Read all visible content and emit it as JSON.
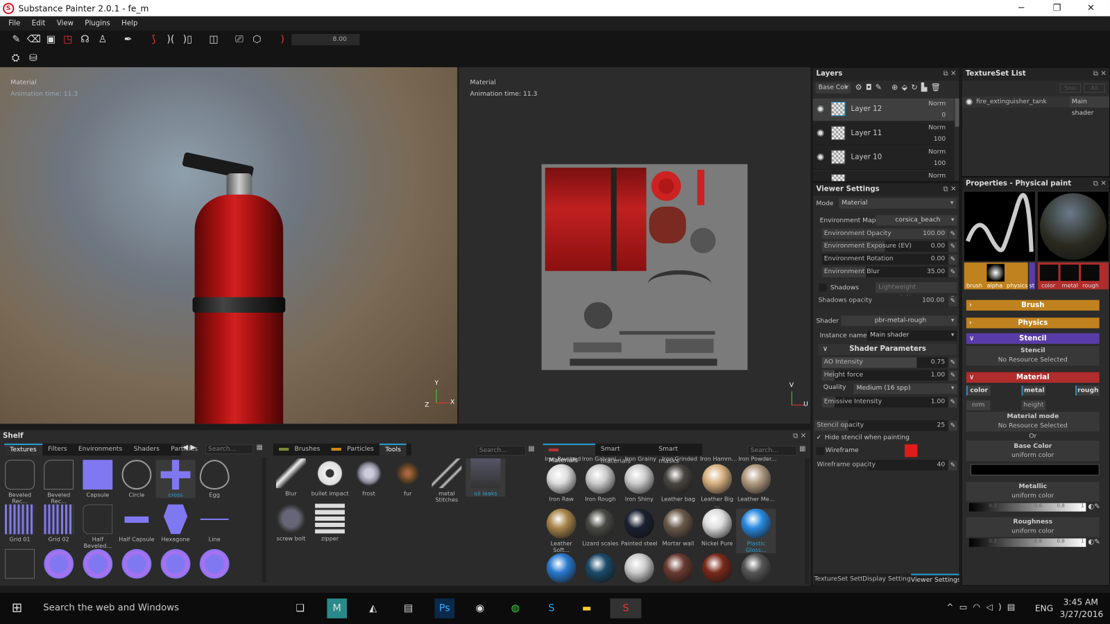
{
  "window": {
    "title": "Substance Painter 2.0.1 - fe_m",
    "min": "─",
    "max": "❐",
    "close": "✕"
  },
  "menu": [
    "File",
    "Edit",
    "View",
    "Plugins",
    "Help"
  ],
  "toolbar": {
    "brush_size": "8.00",
    "icons": [
      "paint-brush-icon",
      "eraser-icon",
      "projection-icon",
      "polygon-fill-icon",
      "smudge-icon",
      "clone-stamp-icon",
      "color-picker-icon",
      "symmetry-icon",
      "mirror-x-icon",
      "mirror-icon",
      "view-mode-icon",
      "camera-icon",
      "cube-icon",
      "lazy-mouse-icon",
      "substance-share-icon",
      "substance-store-icon"
    ]
  },
  "viewport3d": {
    "mode": "Material",
    "animation_time": "Animation time: 11.3",
    "axis_x": "X",
    "axis_y": "Y",
    "axis_z": "Z"
  },
  "viewport2d": {
    "mode": "Material",
    "animation_time": "Animation time: 11.3",
    "axis_u": "U",
    "axis_v": "V"
  },
  "layers": {
    "title": "Layers",
    "channel": "Base Colr",
    "items": [
      {
        "name": "Layer 12",
        "blend": "Norm",
        "opacity": "0",
        "selected": true
      },
      {
        "name": "Layer 11",
        "blend": "Norm",
        "opacity": "100"
      },
      {
        "name": "Layer 10",
        "blend": "Norm",
        "opacity": "100"
      },
      {
        "name": "",
        "blend": "Norm",
        "opacity": ""
      }
    ]
  },
  "textureset": {
    "title": "TextureSet List",
    "solo": "Solo",
    "all": "All",
    "item": "fire_extinguisher_tank",
    "shader": "Main shader"
  },
  "viewer": {
    "title": "Viewer Settings",
    "mode_label": "Mode",
    "mode": "Material",
    "env_map_label": "Environment Map",
    "env_map": "corsica_beach",
    "sliders": [
      {
        "label": "Environment Opacity",
        "value": "100.00",
        "fill": 1.0
      },
      {
        "label": "Environment Exposure (EV)",
        "value": "0.00",
        "fill": 0.5
      },
      {
        "label": "Environment Rotation",
        "value": "0.00",
        "fill": 0.0
      },
      {
        "label": "Environment Blur",
        "value": "35.00",
        "fill": 0.35
      }
    ],
    "shadows_label": "Shadows",
    "shadows_mode": "Lightweight computation",
    "shadows_opacity_label": "Shadows opacity",
    "shadows_opacity": "100.00",
    "shader_label": "Shader",
    "shader": "pbr-metal-rough",
    "instance_label": "Instance name",
    "instance": "Main shader",
    "shader_params": "Shader Parameters",
    "params": [
      {
        "label": "AO Intensity",
        "value": "0.75",
        "fill": 0.75
      },
      {
        "label": "Height force",
        "value": "1.00",
        "fill": 0.1
      }
    ],
    "quality_label": "Quality",
    "quality": "Medium (16 spp)",
    "emissive_label": "Emissive Intensity",
    "emissive": "1.00",
    "stencil_opacity_label": "Stencil opacity",
    "stencil_opacity": "25",
    "hide_stencil": "Hide stencil when painting",
    "wireframe": "Wireframe",
    "wireframe_color": "#e01b1b",
    "wireframe_opacity_label": "Wireframe opacity",
    "wireframe_opacity": "40"
  },
  "bottom_tabs": [
    {
      "label": "TextureSet Settings"
    },
    {
      "label": "Display Settings"
    },
    {
      "label": "Viewer Settings",
      "active": true
    }
  ],
  "properties": {
    "title": "Properties - Physical paint",
    "brush_slots": [
      "brush",
      "alpha",
      "physics",
      "st"
    ],
    "mat_slots": [
      "color",
      "metal",
      "rough"
    ],
    "sections": {
      "brush": "Brush",
      "physics": "Physics",
      "stencil": "Stencil",
      "material": "Material"
    },
    "stencil_title": "Stencil",
    "stencil_value": "No Resource Selected",
    "channels": [
      "color",
      "metal",
      "rough",
      "nrm",
      "height"
    ],
    "material_mode": "Material mode",
    "material_mode_value": "No Resource Selected",
    "or": "Or",
    "base_color": "Base Color",
    "base_color_sub": "uniform color",
    "metallic": "Metallic",
    "metallic_sub": "uniform color",
    "roughness": "Roughness",
    "roughness_sub": "uniform color",
    "ticks": [
      "0.2",
      "0.4",
      "0.6",
      "0.8",
      "1"
    ],
    "colors": {
      "brush": "#c0821e",
      "stencil": "#5a3ca8",
      "material": "#b12c2c"
    }
  },
  "shelf": {
    "title": "Shelf",
    "search": "Search...",
    "tabs1": [
      "Textures",
      "Filters",
      "Environments",
      "Shaders",
      "Particles"
    ],
    "textures": [
      "Beveled Rec...",
      "Beveled Rec...",
      "Capsule",
      "Circle",
      "cross",
      "Egg",
      "Grid 01",
      "Grid 02",
      "Half Beveled...",
      "Half Capsule",
      "Hexagone",
      "Line"
    ],
    "tabs2": [
      "Brushes",
      "Particles",
      "Tools"
    ],
    "tools": [
      "Blur",
      "bullet impact",
      "frost",
      "fur",
      "metal Stitches",
      "oil leaks",
      "screw bolt",
      "zipper"
    ],
    "tabs3": [
      "Materials",
      "Smart materials",
      "Smart masks"
    ],
    "materials_top": [
      "Iron Brushed",
      "Iron Galvani...",
      "Iron Grainy",
      "Iron Grinded",
      "Iron Hamm...",
      "Iron Powder..."
    ],
    "materials": [
      "Iron Raw",
      "Iron Rough",
      "Iron Shiny",
      "Leather bag",
      "Leather Big ...",
      "Leather Me...",
      "Leather Soft...",
      "Lizard scales",
      "Painted steel",
      "Mortar wall",
      "Nickel Pure",
      "Plastic Gloss..."
    ]
  },
  "taskbar": {
    "search": "Search the web and Windows",
    "lang": "ENG",
    "time": "3:45 AM",
    "date": "3/27/2016"
  }
}
